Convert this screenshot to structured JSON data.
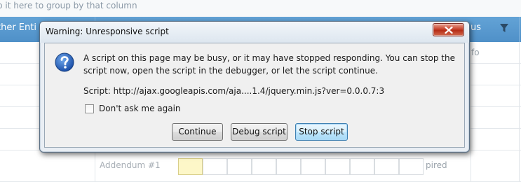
{
  "background": {
    "group_bar_text": "p it here to group by that column",
    "header_left": "ther Enti",
    "header_right": "us",
    "cell_right_top": "fo",
    "cell_addendum": "Addendum #1",
    "cell_expired": "pired"
  },
  "dialog": {
    "title": "Warning: Unresponsive script",
    "message": "A script on this page may be busy, or it may have stopped responding. You can stop the script now, open the script in the debugger, or let the script continue.",
    "script_line": "Script: http://ajax.googleapis.com/aja....1.4/jquery.min.js?ver=0.0.0.7:3",
    "checkbox_label": "Don't ask me again",
    "buttons": {
      "continue": "Continue",
      "debug": "Debug script",
      "stop": "Stop script"
    }
  },
  "colors": {
    "header_bg": "#5b9bd5",
    "dialog_bg": "#e9eef4",
    "close_btn": "#c8452f",
    "default_btn_border": "#3c7fb1"
  }
}
